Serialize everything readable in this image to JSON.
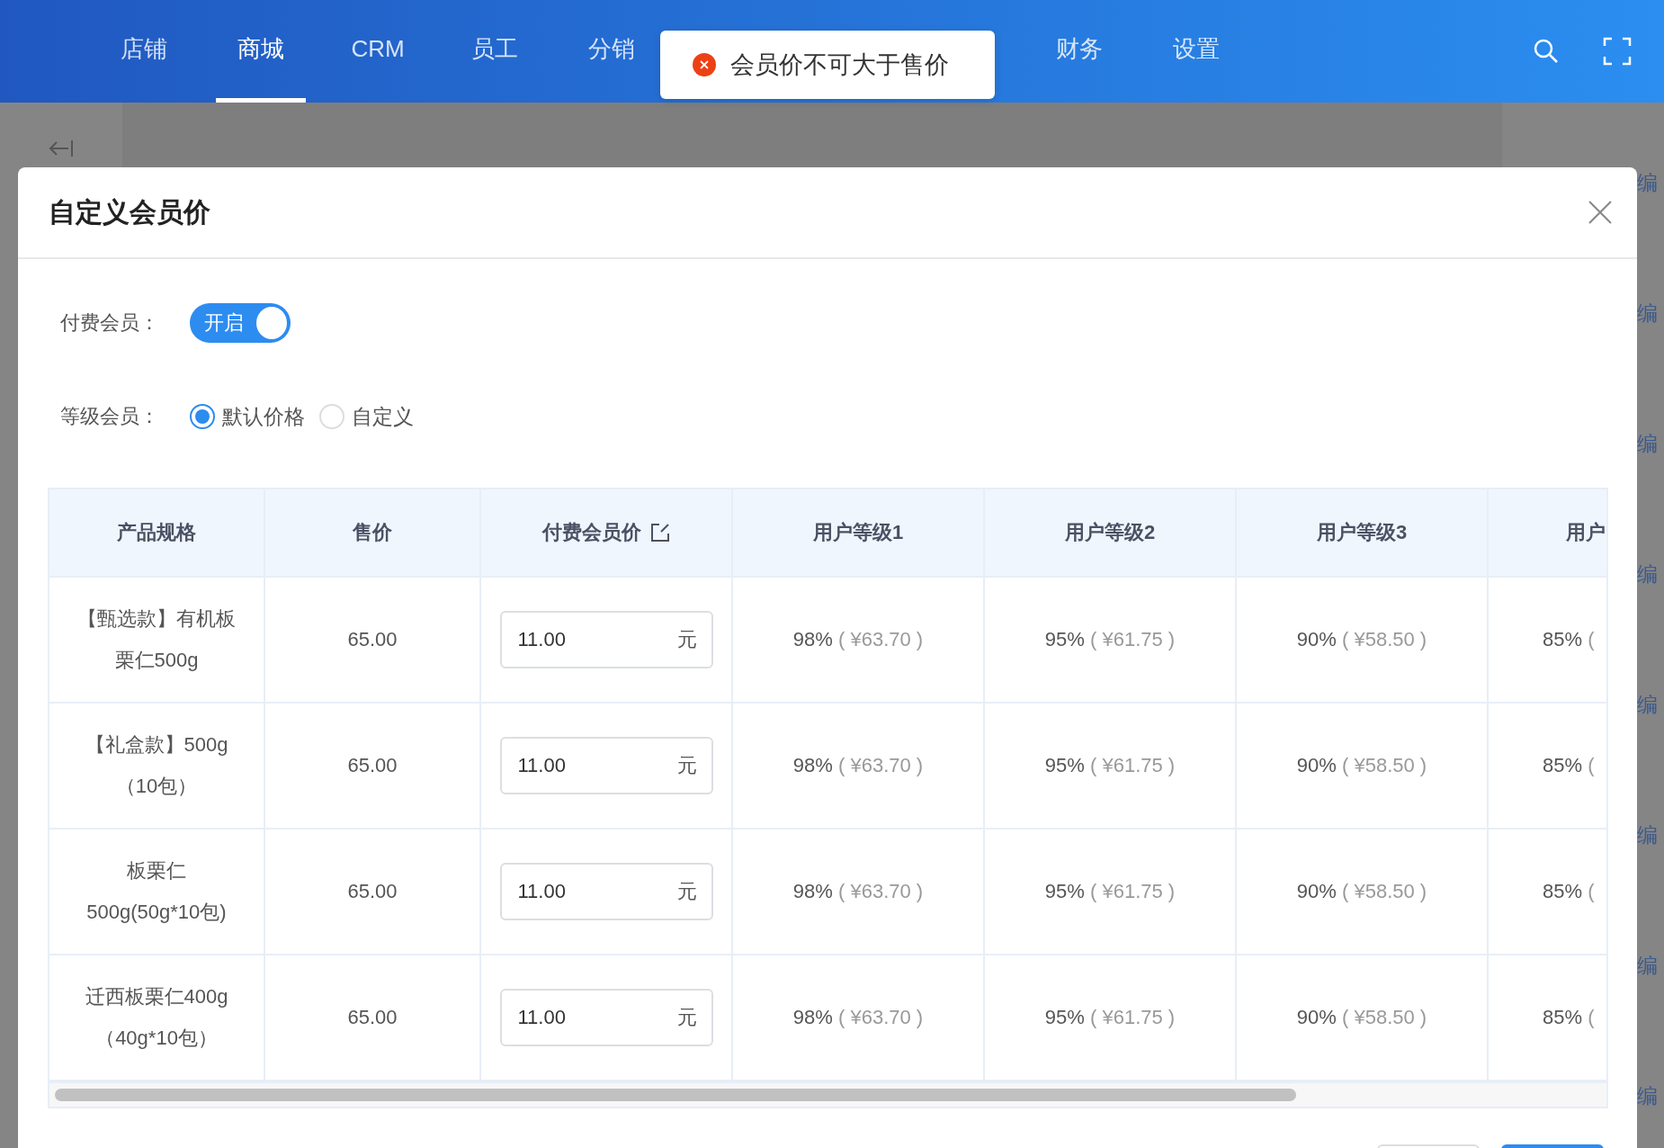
{
  "top_nav": {
    "items": [
      {
        "label": "店铺",
        "selected": false
      },
      {
        "label": "商城",
        "selected": true
      },
      {
        "label": "CRM",
        "selected": false
      },
      {
        "label": "员工",
        "selected": false
      },
      {
        "label": "分销",
        "selected": false
      },
      {
        "label": "财务",
        "selected": false
      },
      {
        "label": "设置",
        "selected": false
      }
    ]
  },
  "toast": {
    "kind": "error",
    "message": "会员价不可大于售价"
  },
  "background_links": [
    "编",
    "编",
    "编",
    "编",
    "编",
    "编",
    "编",
    "编"
  ],
  "dialog": {
    "title": "自定义会员价",
    "paid_member": {
      "label": "付费会员：",
      "on": true,
      "text": "开启"
    },
    "level_member": {
      "label": "等级会员：",
      "options": [
        {
          "label": "默认价格",
          "selected": true
        },
        {
          "label": "自定义",
          "selected": false
        }
      ]
    },
    "table": {
      "columns": [
        {
          "label": "产品规格",
          "editable": false
        },
        {
          "label": "售价",
          "editable": false
        },
        {
          "label": "付费会员价",
          "editable": true
        },
        {
          "label": "用户等级1",
          "editable": false
        },
        {
          "label": "用户等级2",
          "editable": false
        },
        {
          "label": "用户等级3",
          "editable": false
        },
        {
          "label": "用户"
        }
      ],
      "rows": [
        {
          "spec": "【甄选款】有机板栗仁500g",
          "price": "65.00",
          "member_price": "11.00",
          "unit": "元",
          "levels": [
            {
              "rate": "98%",
              "amount": "( ¥63.70 )"
            },
            {
              "rate": "95%",
              "amount": "( ¥61.75 )"
            },
            {
              "rate": "90%",
              "amount": "( ¥58.50 )"
            },
            {
              "rate": "85%",
              "amount": "("
            }
          ]
        },
        {
          "spec": "【礼盒款】500g（10包）",
          "price": "65.00",
          "member_price": "11.00",
          "unit": "元",
          "levels": [
            {
              "rate": "98%",
              "amount": "( ¥63.70 )"
            },
            {
              "rate": "95%",
              "amount": "( ¥61.75 )"
            },
            {
              "rate": "90%",
              "amount": "( ¥58.50 )"
            },
            {
              "rate": "85%",
              "amount": "("
            }
          ]
        },
        {
          "spec": "板栗仁500g(50g*10包)",
          "price": "65.00",
          "member_price": "11.00",
          "unit": "元",
          "levels": [
            {
              "rate": "98%",
              "amount": "( ¥63.70 )"
            },
            {
              "rate": "95%",
              "amount": "( ¥61.75 )"
            },
            {
              "rate": "90%",
              "amount": "( ¥58.50 )"
            },
            {
              "rate": "85%",
              "amount": "("
            }
          ]
        },
        {
          "spec": "迁西板栗仁400g（40g*10包）",
          "price": "65.00",
          "member_price": "11.00",
          "unit": "元",
          "levels": [
            {
              "rate": "98%",
              "amount": "( ¥63.70 )"
            },
            {
              "rate": "95%",
              "amount": "( ¥61.75 )"
            },
            {
              "rate": "90%",
              "amount": "( ¥58.50 )"
            },
            {
              "rate": "85%",
              "amount": "("
            }
          ]
        }
      ]
    }
  }
}
